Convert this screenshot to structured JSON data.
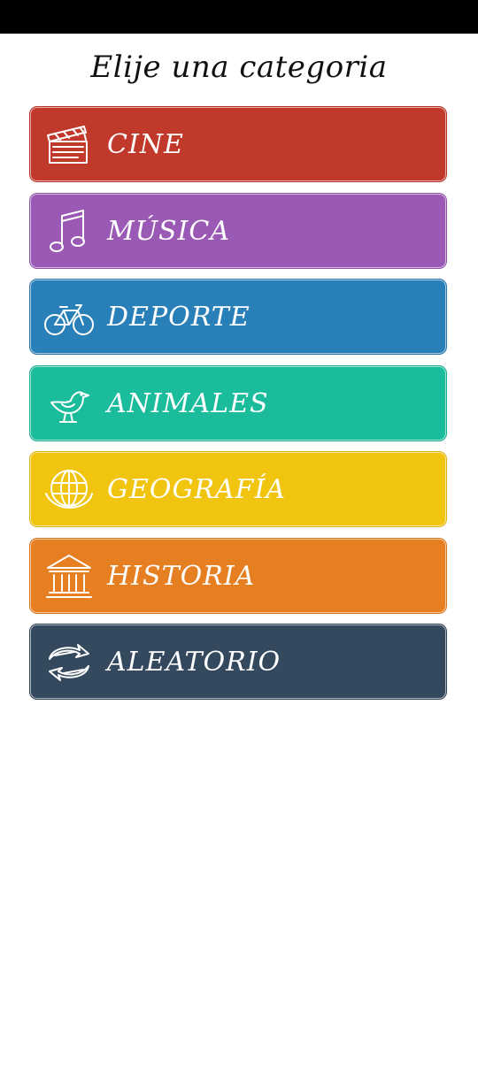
{
  "header": {
    "title": "Elije una categoria"
  },
  "categories": [
    {
      "label": "CINE",
      "icon": "film-clapper-icon",
      "color": "#c0392b"
    },
    {
      "label": "MÚSICA",
      "icon": "music-note-icon",
      "color": "#9b59b6"
    },
    {
      "label": "DEPORTE",
      "icon": "bicycle-icon",
      "color": "#2980b9"
    },
    {
      "label": "ANIMALES",
      "icon": "bird-icon",
      "color": "#1abc9c"
    },
    {
      "label": "GEOGRAFÍA",
      "icon": "globe-icon",
      "color": "#f1c40f"
    },
    {
      "label": "HISTORIA",
      "icon": "museum-icon",
      "color": "#e67e22"
    },
    {
      "label": "ALEATORIO",
      "icon": "shuffle-arrows-icon",
      "color": "#34495e"
    }
  ]
}
